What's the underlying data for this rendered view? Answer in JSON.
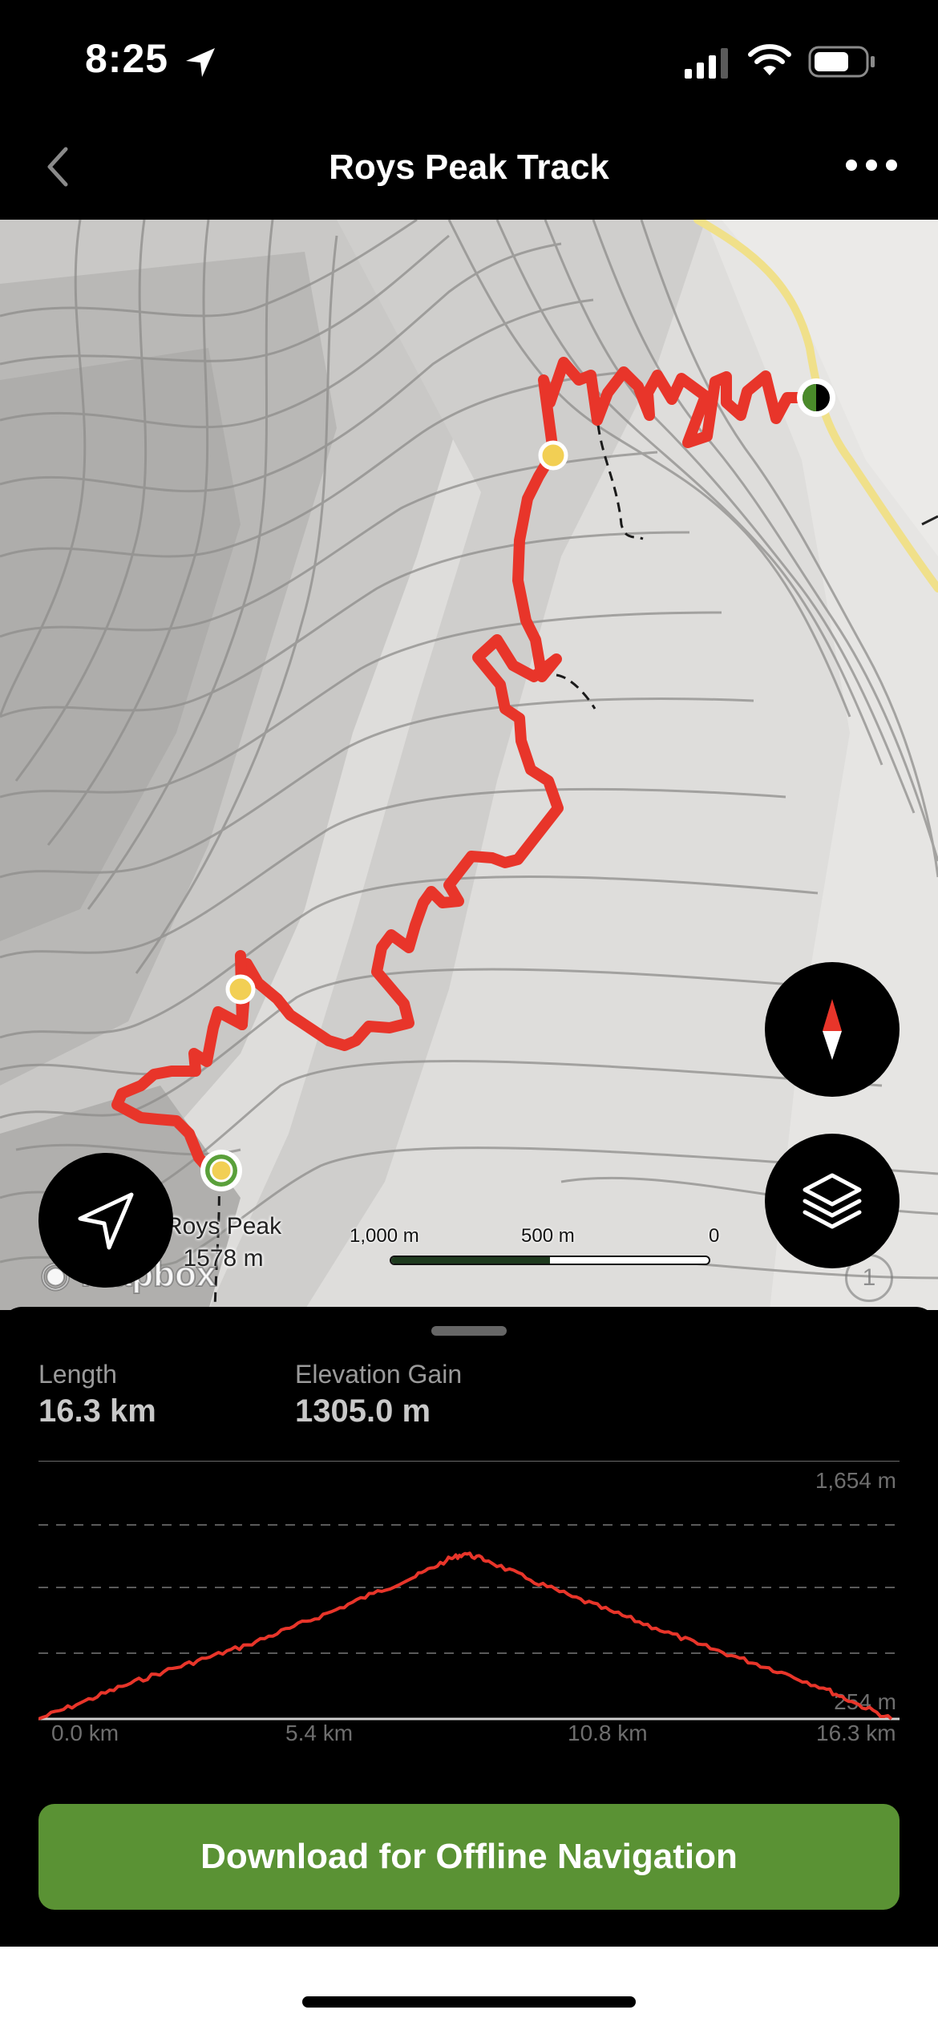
{
  "status_bar": {
    "time": "8:25"
  },
  "nav": {
    "title": "Roys Peak Track"
  },
  "map": {
    "peak_name": "Roys Peak",
    "peak_elevation": "1578 m",
    "scale_labels": [
      "1,000 m",
      "500 m",
      "0"
    ],
    "attribution": "mapbox",
    "info_label": "1",
    "route_color": "#e8352a",
    "road_color": "#f0e08a"
  },
  "stats": {
    "length_label": "Length",
    "length_value": "16.3 km",
    "gain_label": "Elevation Gain",
    "gain_value": "1305.0 m"
  },
  "chart_data": {
    "type": "line",
    "title": "",
    "xlabel": "",
    "ylabel": "",
    "x_ticks": [
      "0.0 km",
      "5.4 km",
      "10.8 km",
      "16.3 km"
    ],
    "y_tick_labels": [
      "1,654 m",
      "254 m"
    ],
    "xlim": [
      0,
      16.3
    ],
    "ylim": [
      254,
      1654
    ],
    "grid": "dashed-horizontal",
    "series": [
      {
        "color": "#e8352a",
        "x": [
          0,
          0.8,
          1.6,
          2.4,
          3.2,
          4.0,
          4.8,
          5.6,
          6.4,
          7.2,
          7.8,
          8.15,
          8.6,
          9.4,
          10.2,
          11.0,
          11.8,
          12.6,
          13.4,
          14.2,
          15.0,
          15.6,
          16.3
        ],
        "y": [
          254,
          350,
          450,
          540,
          620,
          700,
          800,
          900,
          1010,
          1110,
          1210,
          1250,
          1205,
          1090,
          990,
          895,
          800,
          705,
          620,
          535,
          440,
          350,
          254
        ]
      }
    ]
  },
  "actions": {
    "download_label": "Download for Offline Navigation"
  }
}
